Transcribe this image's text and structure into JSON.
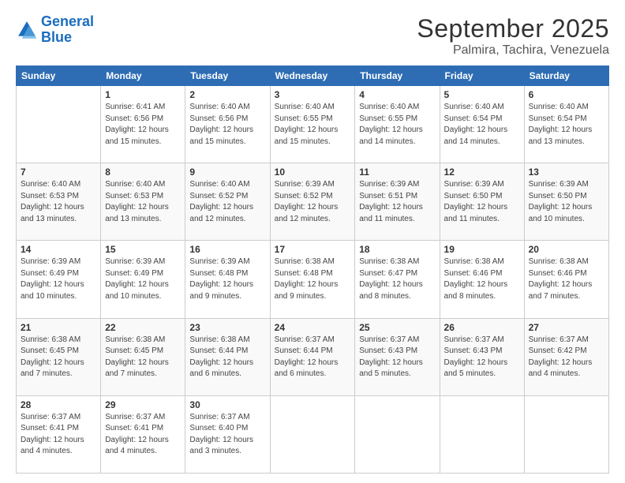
{
  "header": {
    "logo_line1": "General",
    "logo_line2": "Blue",
    "month": "September 2025",
    "location": "Palmira, Tachira, Venezuela"
  },
  "days_of_week": [
    "Sunday",
    "Monday",
    "Tuesday",
    "Wednesday",
    "Thursday",
    "Friday",
    "Saturday"
  ],
  "weeks": [
    [
      {
        "day": "",
        "info": ""
      },
      {
        "day": "1",
        "info": "Sunrise: 6:41 AM\nSunset: 6:56 PM\nDaylight: 12 hours\nand 15 minutes."
      },
      {
        "day": "2",
        "info": "Sunrise: 6:40 AM\nSunset: 6:56 PM\nDaylight: 12 hours\nand 15 minutes."
      },
      {
        "day": "3",
        "info": "Sunrise: 6:40 AM\nSunset: 6:55 PM\nDaylight: 12 hours\nand 15 minutes."
      },
      {
        "day": "4",
        "info": "Sunrise: 6:40 AM\nSunset: 6:55 PM\nDaylight: 12 hours\nand 14 minutes."
      },
      {
        "day": "5",
        "info": "Sunrise: 6:40 AM\nSunset: 6:54 PM\nDaylight: 12 hours\nand 14 minutes."
      },
      {
        "day": "6",
        "info": "Sunrise: 6:40 AM\nSunset: 6:54 PM\nDaylight: 12 hours\nand 13 minutes."
      }
    ],
    [
      {
        "day": "7",
        "info": "Sunrise: 6:40 AM\nSunset: 6:53 PM\nDaylight: 12 hours\nand 13 minutes."
      },
      {
        "day": "8",
        "info": "Sunrise: 6:40 AM\nSunset: 6:53 PM\nDaylight: 12 hours\nand 13 minutes."
      },
      {
        "day": "9",
        "info": "Sunrise: 6:40 AM\nSunset: 6:52 PM\nDaylight: 12 hours\nand 12 minutes."
      },
      {
        "day": "10",
        "info": "Sunrise: 6:39 AM\nSunset: 6:52 PM\nDaylight: 12 hours\nand 12 minutes."
      },
      {
        "day": "11",
        "info": "Sunrise: 6:39 AM\nSunset: 6:51 PM\nDaylight: 12 hours\nand 11 minutes."
      },
      {
        "day": "12",
        "info": "Sunrise: 6:39 AM\nSunset: 6:50 PM\nDaylight: 12 hours\nand 11 minutes."
      },
      {
        "day": "13",
        "info": "Sunrise: 6:39 AM\nSunset: 6:50 PM\nDaylight: 12 hours\nand 10 minutes."
      }
    ],
    [
      {
        "day": "14",
        "info": "Sunrise: 6:39 AM\nSunset: 6:49 PM\nDaylight: 12 hours\nand 10 minutes."
      },
      {
        "day": "15",
        "info": "Sunrise: 6:39 AM\nSunset: 6:49 PM\nDaylight: 12 hours\nand 10 minutes."
      },
      {
        "day": "16",
        "info": "Sunrise: 6:39 AM\nSunset: 6:48 PM\nDaylight: 12 hours\nand 9 minutes."
      },
      {
        "day": "17",
        "info": "Sunrise: 6:38 AM\nSunset: 6:48 PM\nDaylight: 12 hours\nand 9 minutes."
      },
      {
        "day": "18",
        "info": "Sunrise: 6:38 AM\nSunset: 6:47 PM\nDaylight: 12 hours\nand 8 minutes."
      },
      {
        "day": "19",
        "info": "Sunrise: 6:38 AM\nSunset: 6:46 PM\nDaylight: 12 hours\nand 8 minutes."
      },
      {
        "day": "20",
        "info": "Sunrise: 6:38 AM\nSunset: 6:46 PM\nDaylight: 12 hours\nand 7 minutes."
      }
    ],
    [
      {
        "day": "21",
        "info": "Sunrise: 6:38 AM\nSunset: 6:45 PM\nDaylight: 12 hours\nand 7 minutes."
      },
      {
        "day": "22",
        "info": "Sunrise: 6:38 AM\nSunset: 6:45 PM\nDaylight: 12 hours\nand 7 minutes."
      },
      {
        "day": "23",
        "info": "Sunrise: 6:38 AM\nSunset: 6:44 PM\nDaylight: 12 hours\nand 6 minutes."
      },
      {
        "day": "24",
        "info": "Sunrise: 6:37 AM\nSunset: 6:44 PM\nDaylight: 12 hours\nand 6 minutes."
      },
      {
        "day": "25",
        "info": "Sunrise: 6:37 AM\nSunset: 6:43 PM\nDaylight: 12 hours\nand 5 minutes."
      },
      {
        "day": "26",
        "info": "Sunrise: 6:37 AM\nSunset: 6:43 PM\nDaylight: 12 hours\nand 5 minutes."
      },
      {
        "day": "27",
        "info": "Sunrise: 6:37 AM\nSunset: 6:42 PM\nDaylight: 12 hours\nand 4 minutes."
      }
    ],
    [
      {
        "day": "28",
        "info": "Sunrise: 6:37 AM\nSunset: 6:41 PM\nDaylight: 12 hours\nand 4 minutes."
      },
      {
        "day": "29",
        "info": "Sunrise: 6:37 AM\nSunset: 6:41 PM\nDaylight: 12 hours\nand 4 minutes."
      },
      {
        "day": "30",
        "info": "Sunrise: 6:37 AM\nSunset: 6:40 PM\nDaylight: 12 hours\nand 3 minutes."
      },
      {
        "day": "",
        "info": ""
      },
      {
        "day": "",
        "info": ""
      },
      {
        "day": "",
        "info": ""
      },
      {
        "day": "",
        "info": ""
      }
    ]
  ]
}
